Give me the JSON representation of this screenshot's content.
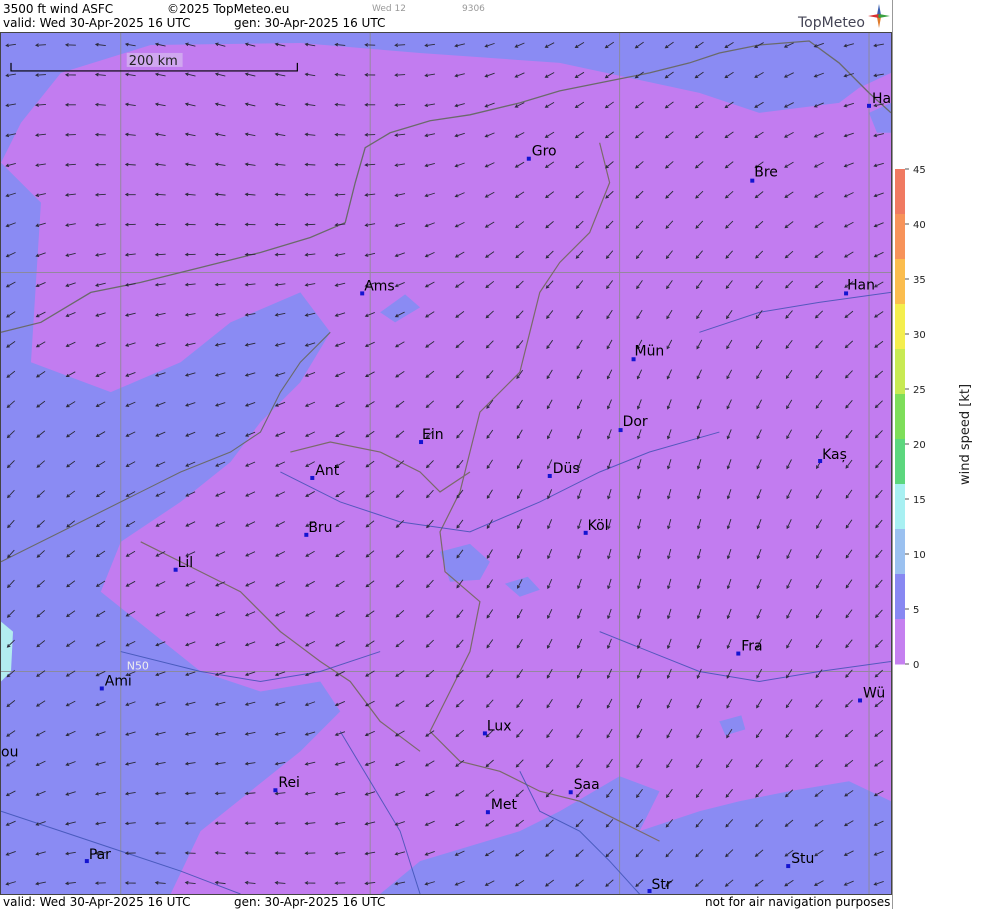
{
  "header": {
    "title": "3500 ft wind ASFC",
    "copyright": "©2025 TopMeteo.eu",
    "valid": "valid:  Wed  30-Apr-2025  16 UTC",
    "gen": "gen: 30-Apr-2025 16 UTC",
    "faint_day": "Wed 12",
    "faint_id": "9306",
    "brand": "TopMeteo"
  },
  "footer": {
    "valid": "valid:  Wed  30-Apr-2025  16 UTC",
    "gen": "gen: 30-Apr-2025 16 UTC",
    "disclaimer": "not for air navigation purposes"
  },
  "map": {
    "scale_label": "200 km",
    "lat_label": "N50",
    "cities": [
      "Ha",
      "Gro",
      "Bre",
      "Ams",
      "Han",
      "Mün",
      "Ein",
      "Dor",
      "Ant",
      "Düs",
      "Kaș",
      "Bru",
      "Köl",
      "Lil",
      "Fra",
      "Ami",
      "Wü",
      "Lux",
      "ou",
      "Rei",
      "Saa",
      "Met",
      "Par",
      "Stu",
      "Str"
    ]
  },
  "legend": {
    "title": "wind  speed  [kt]",
    "ticks": [
      "45",
      "40",
      "35",
      "30",
      "25",
      "20",
      "15",
      "10",
      "5",
      "0"
    ],
    "colors": [
      "#f07a62",
      "#f7935a",
      "#fbbd4e",
      "#f4ee4e",
      "#c8ea54",
      "#7ede5a",
      "#5cd77e",
      "#a8f0f2",
      "#9bc1f0",
      "#8888f2",
      "#c580f0"
    ]
  },
  "colors": {
    "calm": "#c27cf0",
    "light": "#9a86f0",
    "moderate": "#8a8bf3",
    "coast": "#b2ecf0"
  }
}
